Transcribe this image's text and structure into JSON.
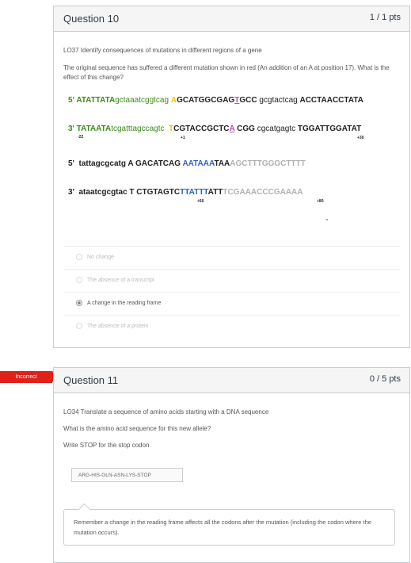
{
  "q10": {
    "title": "Question 10",
    "points": "1 / 1 pts",
    "objective": "LO37 Identify consequences of mutations in different regions of  a gene",
    "prompt": "The original sequence has suffered a different mutation shown in red (An addition of an A at position 17). What is the effect of this change?",
    "line1": [
      "5' ATATTATA",
      "gctaaatcggtcag ",
      "A",
      "GCATGGCGAG",
      "T",
      "GCC ",
      "gcgtactcag ",
      "ACCTAACCTATA"
    ],
    "line2": [
      "3' TATAATA",
      "tcgatttagccagtc  ",
      "T",
      "CGTACCGCTC",
      "A",
      " CGG ",
      "cgcatgagtc ",
      "TGGATTGGATAT"
    ],
    "line2_labels": [
      "-22",
      "+1",
      "+30"
    ],
    "line3": [
      "5'  tattagcgcatg ",
      "A GACATCAG ",
      "AATAAA",
      "TAA",
      "AGCTTTGGGCTTTT"
    ],
    "line4": [
      "3'  ataatcgcgtac ",
      "T CTGTAGTC",
      "TTATTT",
      "ATT",
      "TCGAAACCCGAAAA"
    ],
    "line4_labels": [
      "+60",
      "+80"
    ],
    "answers": [
      {
        "label": "No change",
        "selected": false
      },
      {
        "label": "The absence of a transcript",
        "selected": false
      },
      {
        "label": "A change in the reading frame",
        "selected": true
      },
      {
        "label": "The absence of a protein",
        "selected": false
      }
    ]
  },
  "q11": {
    "status": "Incorrect",
    "title": "Question 11",
    "points": "0 / 5 pts",
    "objective": "LO34 Translate a sequence of amino acids starting with a DNA sequence",
    "prompt1": "What is the amino acid sequence for this new allele?",
    "prompt2": "Write STOP for the stop codon",
    "answer": "ARG-HIS-GLN-ASN-LYS-STOP",
    "feedback": "Remember a change in the reading frame affects all the codons after the mutation (including the codon where the mutation occurs)."
  }
}
